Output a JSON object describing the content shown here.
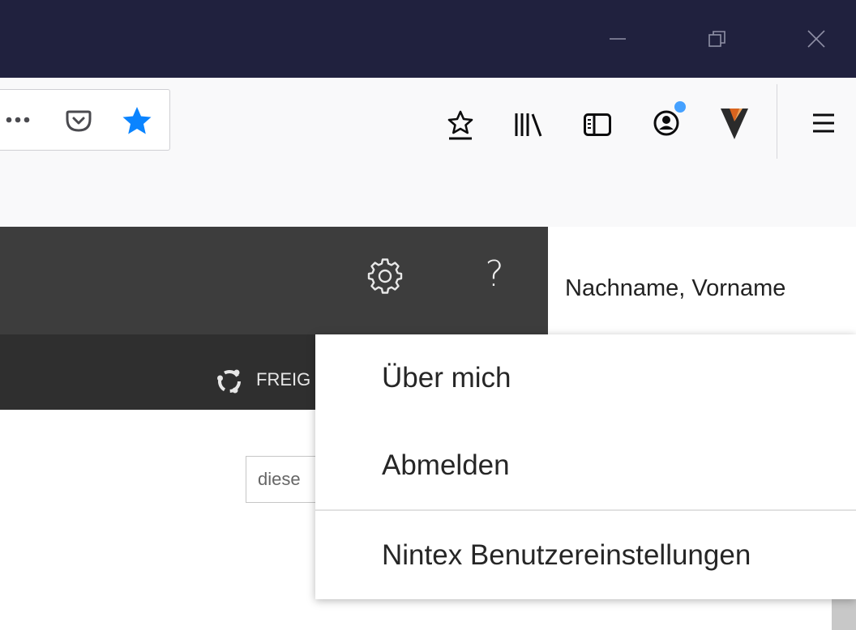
{
  "window_controls": {
    "minimize": "minimize-icon",
    "restore": "restore-icon",
    "close": "close-icon"
  },
  "browser_toolbar": {
    "url_bar_icons": [
      "more-actions-icon",
      "pocket-icon",
      "bookmark-star-icon"
    ],
    "icons": [
      "bookmarks-menu-icon",
      "library-icon",
      "sidebar-icon",
      "account-icon",
      "extension-icon",
      "hamburger-menu-icon"
    ],
    "colors": {
      "star": "#0a84ff",
      "notification_dot": "#45a1ff",
      "extension_dark": "#2b2b2b",
      "extension_accent": "#d9641e"
    }
  },
  "site_header": {
    "user_name": "Nachname, Vorname",
    "help_label": "?",
    "settings_icon": "gear-icon",
    "help_icon": "question-mark-icon"
  },
  "subnav": {
    "share_label": "FREIG",
    "share_icon": "sync-icon"
  },
  "search": {
    "value": "diese"
  },
  "user_menu": {
    "items": [
      {
        "label": "Über mich"
      },
      {
        "label": "Abmelden"
      },
      {
        "label": "Nintex Benutzereinstellungen"
      }
    ]
  },
  "colors": {
    "titlebar": "#20213e",
    "toolbar": "#f9f9fa",
    "site_header": "#3d3d3d",
    "subnav": "#2f2f2f"
  }
}
